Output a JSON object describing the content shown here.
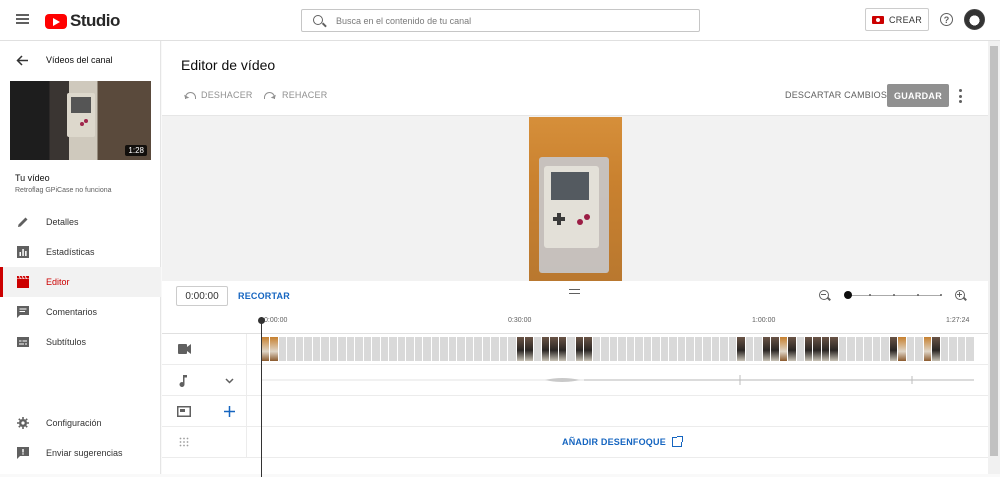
{
  "header": {
    "logo_text": "Studio",
    "search_placeholder": "Busca en el contenido de tu canal",
    "create_label": "CREAR",
    "help_label": "?"
  },
  "sidebar": {
    "back_label": "Vídeos del canal",
    "thumbnail_duration": "1:28",
    "your_video_label": "Tu vídeo",
    "video_title": "Retroflag GPiCase no funciona",
    "nav_top": [
      {
        "label": "Detalles",
        "icon": "pencil-icon",
        "active": false
      },
      {
        "label": "Estadísticas",
        "icon": "bar-chart-icon",
        "active": false
      },
      {
        "label": "Editor",
        "icon": "clapperboard-icon",
        "active": true
      },
      {
        "label": "Comentarios",
        "icon": "comment-icon",
        "active": false
      },
      {
        "label": "Subtítulos",
        "icon": "subtitles-icon",
        "active": false
      }
    ],
    "nav_bottom": [
      {
        "label": "Configuración",
        "icon": "gear-icon"
      },
      {
        "label": "Enviar sugerencias",
        "icon": "feedback-icon"
      }
    ]
  },
  "editor": {
    "title": "Editor de vídeo",
    "undo_label": "DESHACER",
    "redo_label": "REHACER",
    "discard_label": "DESCARTAR CAMBIOS",
    "save_label": "GUARDAR",
    "current_time": "0:00:00",
    "trim_label": "RECORTAR",
    "ruler_ticks": [
      "0:00:00",
      "0:30:00",
      "1:00:00",
      "1:27:24"
    ],
    "blur_label": "AÑADIR DESENFOQUE"
  },
  "colors": {
    "accent_red": "#cc0000",
    "link_blue": "#1565c0",
    "save_disabled": "#909090"
  }
}
